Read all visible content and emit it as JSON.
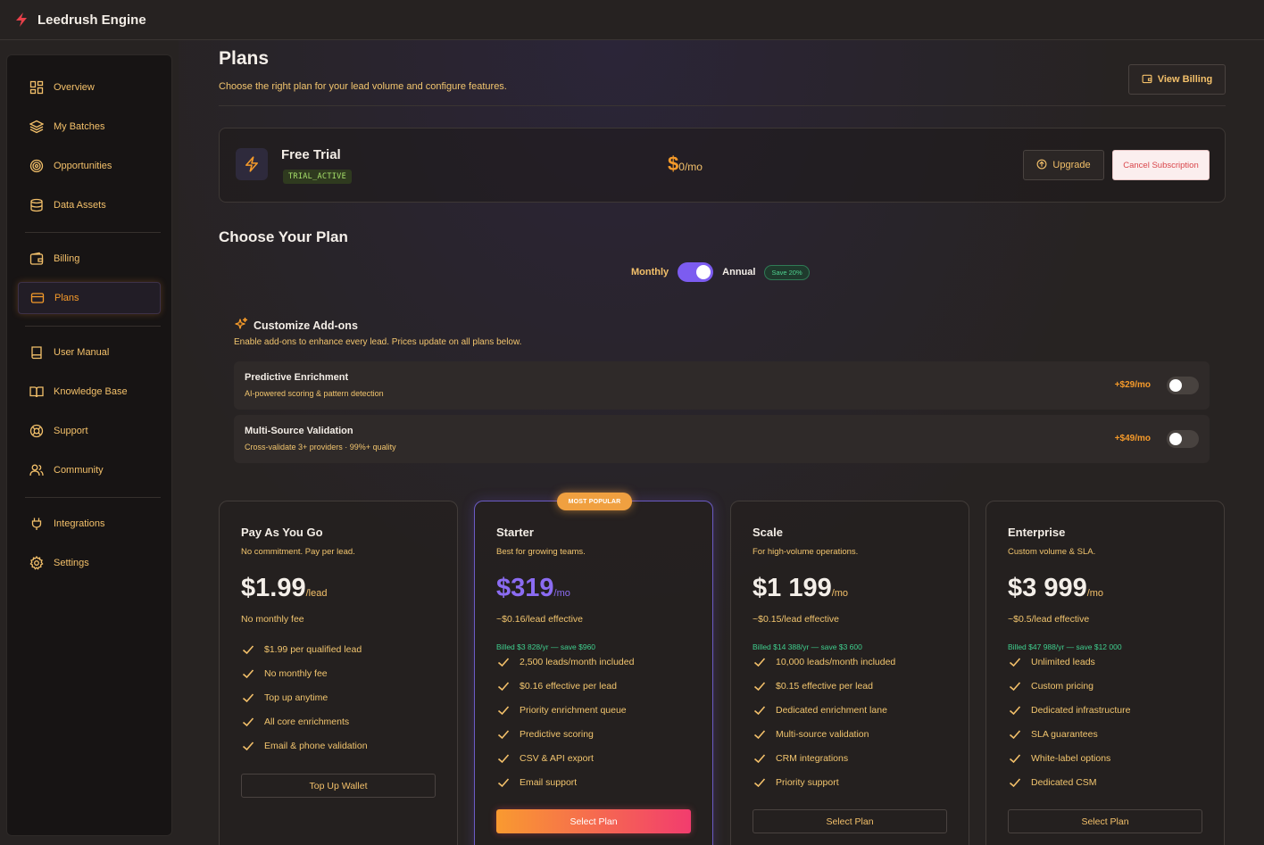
{
  "app": {
    "title": "Leedrush Engine"
  },
  "sidebar": {
    "items": [
      {
        "label": "Overview",
        "icon": "grid-icon"
      },
      {
        "label": "My Batches",
        "icon": "layers-icon"
      },
      {
        "label": "Opportunities",
        "icon": "target-icon"
      },
      {
        "label": "Data Assets",
        "icon": "database-icon"
      },
      {
        "label": "Billing",
        "icon": "wallet-icon"
      },
      {
        "label": "Plans",
        "icon": "credit-card-icon",
        "active": true
      },
      {
        "label": "User Manual",
        "icon": "book-icon"
      },
      {
        "label": "Knowledge Base",
        "icon": "book-open-icon"
      },
      {
        "label": "Support",
        "icon": "life-buoy-icon"
      },
      {
        "label": "Community",
        "icon": "users-icon"
      },
      {
        "label": "Integrations",
        "icon": "plug-icon"
      },
      {
        "label": "Settings",
        "icon": "gear-icon"
      }
    ]
  },
  "header": {
    "title": "Plans",
    "subtitle": "Choose the right plan for your lead volume and configure features.",
    "view_billing_label": "View Billing"
  },
  "current_plan": {
    "name": "Free Trial",
    "status": "TRIAL_ACTIVE",
    "price_symbol": "$",
    "price_value": "0",
    "price_period": "/mo",
    "upgrade_label": "Upgrade",
    "cancel_label": "Cancel Subscription"
  },
  "choose": {
    "title": "Choose Your Plan",
    "monthly_label": "Monthly",
    "annual_label": "Annual",
    "save_badge": "Save 20%",
    "annual_selected": true
  },
  "addons": {
    "title": "Customize Add-ons",
    "subtitle": "Enable add-ons to enhance every lead. Prices update on all plans below.",
    "items": [
      {
        "name": "Predictive Enrichment",
        "desc": "AI-powered scoring & pattern detection",
        "price": "+$29/mo",
        "enabled": false
      },
      {
        "name": "Multi-Source Validation",
        "desc": "Cross-validate 3+ providers · 99%+ quality",
        "price": "+$49/mo",
        "enabled": false
      }
    ]
  },
  "plans": [
    {
      "name": "Pay As You Go",
      "desc": "No commitment. Pay per lead.",
      "price": "$1.99",
      "unit": "/lead",
      "effective": "No monthly fee",
      "billed": "",
      "features": [
        "$1.99 per qualified lead",
        "No monthly fee",
        "Top up anytime",
        "All core enrichments",
        "Email & phone validation"
      ],
      "button": "Top Up Wallet"
    },
    {
      "name": "Starter",
      "desc": "Best for growing teams.",
      "badge": "MOST POPULAR",
      "price": "$319",
      "unit": "/mo",
      "effective": "~$0.16/lead effective",
      "billed": "Billed $3 828/yr — save $960",
      "features": [
        "2,500 leads/month included",
        "$0.16 effective per lead",
        "Priority enrichment queue",
        "Predictive scoring",
        "CSV & API export",
        "Email support"
      ],
      "button": "Select Plan"
    },
    {
      "name": "Scale",
      "desc": "For high-volume operations.",
      "price": "$1 199",
      "unit": "/mo",
      "effective": "~$0.15/lead effective",
      "billed": "Billed $14 388/yr — save $3 600",
      "features": [
        "10,000 leads/month included",
        "$0.15 effective per lead",
        "Dedicated enrichment lane",
        "Multi-source validation",
        "CRM integrations",
        "Priority support"
      ],
      "button": "Select Plan"
    },
    {
      "name": "Enterprise",
      "desc": "Custom volume & SLA.",
      "price": "$3 999",
      "unit": "/mo",
      "effective": "~$0.5/lead effective",
      "billed": "Billed $47 988/yr — save $12 000",
      "features": [
        "Unlimited leads",
        "Custom pricing",
        "Dedicated infrastructure",
        "SLA guarantees",
        "White-label options",
        "Dedicated CSM"
      ],
      "button": "Select Plan"
    }
  ],
  "colors": {
    "accent": "#f59a2a",
    "purple": "#7c5cf0",
    "green": "#3fcf8e",
    "text_gold": "#f3c06a"
  }
}
